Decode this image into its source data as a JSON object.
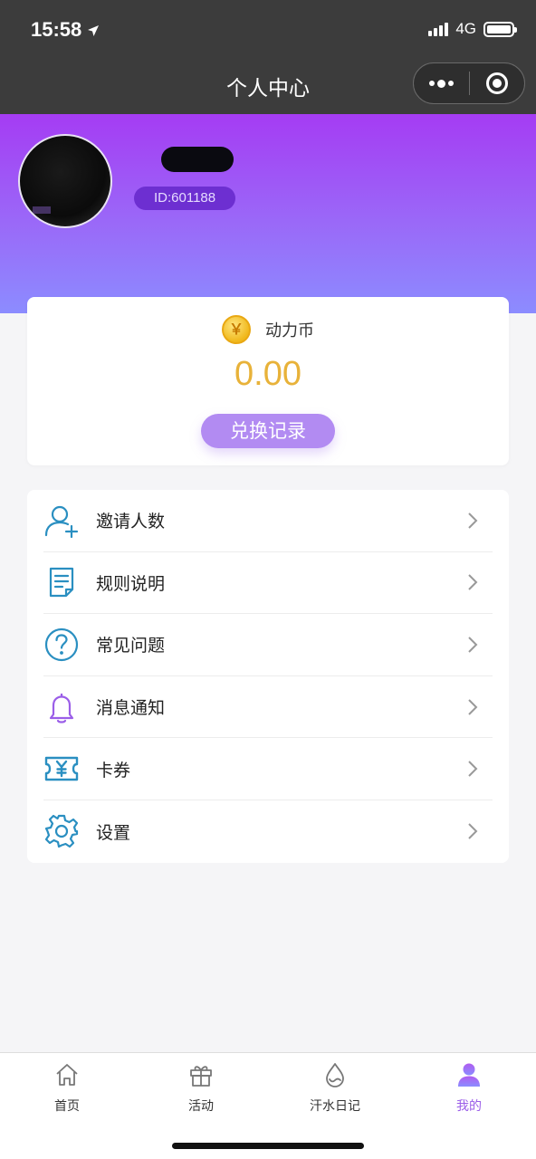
{
  "status_bar": {
    "time": "15:58",
    "network": "4G"
  },
  "nav": {
    "title": "个人中心"
  },
  "profile": {
    "user_id": "ID:601188"
  },
  "coin": {
    "label": "动力币",
    "symbol": "￥",
    "amount": "0.00",
    "exchange_label": "兑换记录"
  },
  "menu": {
    "items": [
      {
        "label": "邀请人数",
        "icon": "user-add-icon"
      },
      {
        "label": "规则说明",
        "icon": "document-icon"
      },
      {
        "label": "常见问题",
        "icon": "question-icon"
      },
      {
        "label": "消息通知",
        "icon": "bell-icon"
      },
      {
        "label": "卡券",
        "icon": "ticket-icon"
      },
      {
        "label": "设置",
        "icon": "gear-icon"
      }
    ]
  },
  "tabs": [
    {
      "label": "首页",
      "icon": "home-icon"
    },
    {
      "label": "活动",
      "icon": "gift-icon"
    },
    {
      "label": "汗水日记",
      "icon": "droplet-icon"
    },
    {
      "label": "我的",
      "icon": "user-icon",
      "active": true
    }
  ],
  "colors": {
    "accent": "#9b5ee8",
    "coin": "#e8b239",
    "icon_blue": "#2a8fc1"
  }
}
